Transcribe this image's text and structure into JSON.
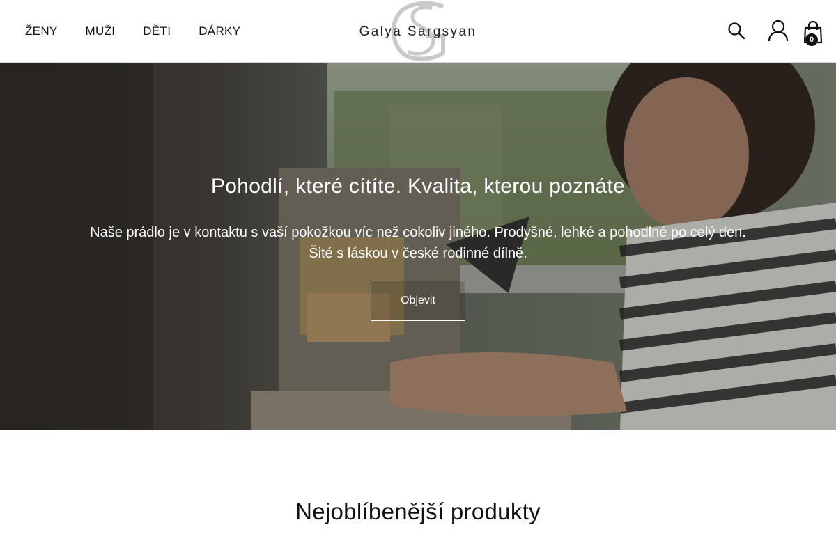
{
  "nav": {
    "items": [
      {
        "label": "ŽENY"
      },
      {
        "label": "MUŽI"
      },
      {
        "label": "DĚTI"
      },
      {
        "label": "DÁRKY"
      }
    ]
  },
  "logo": {
    "monogram": "GS",
    "brand": "Galya Sargsyan"
  },
  "header_icons": {
    "search": "search-icon",
    "account": "user-icon",
    "cart": "shopping-bag-icon",
    "cart_count": "0"
  },
  "hero": {
    "title": "Pohodlí, které cítíte. Kvalita, kterou poznáte",
    "text": "Naše prádlo je v kontaktu s vaší pokožkou víc než cokoliv jiného. Prodyšné, lehké a pohodlné po celý den. Šité s láskou v české rodinné dílně.",
    "button_label": "Objevit"
  },
  "section": {
    "title": "Nejoblíbenější produkty"
  }
}
